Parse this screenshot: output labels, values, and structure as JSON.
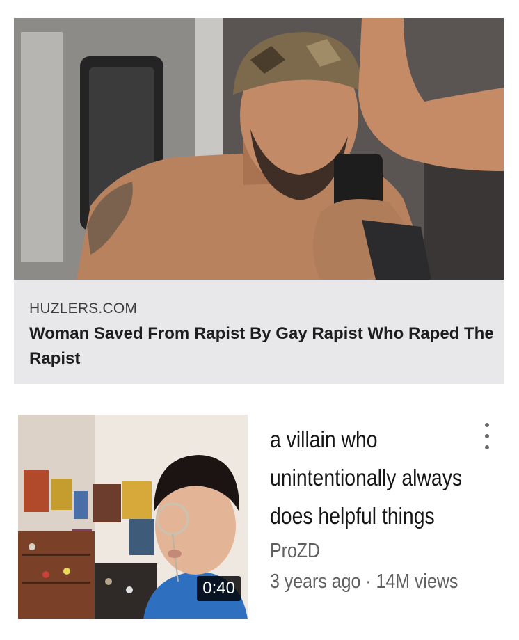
{
  "link_card": {
    "domain": "HUZLERS.COM",
    "title": "Woman Saved From Rapist By Gay Rapist Who Raped The Rapist",
    "image": "man-gym-selfie-photo"
  },
  "video": {
    "title": "a villain who unintentionally always does helpful things",
    "channel": "ProZD",
    "meta": "3 years ago · 14M views",
    "duration": "0:40",
    "thumbnail": "person-with-monocle-photo",
    "more_icon": "more-vert-icon"
  },
  "colors": {
    "card_bg": "#e8e8ea",
    "title_text": "#1d1d1d",
    "secondary_text": "#5f5f5f"
  }
}
